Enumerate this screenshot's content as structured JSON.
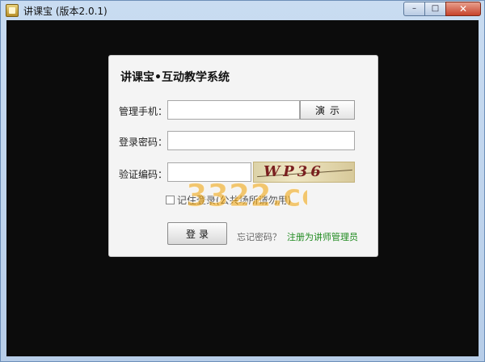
{
  "window": {
    "title": "讲课宝 (版本2.0.1)",
    "controls": {
      "minimize": "–",
      "maximize": "□",
      "close": "✕"
    }
  },
  "login": {
    "heading": "讲课宝•互动教学系统",
    "phone_label": "管理手机：",
    "phone_value": "",
    "demo_button": "演示",
    "password_label": "登录密码：",
    "password_value": "",
    "captcha_label": "验证编码：",
    "captcha_value": "",
    "captcha_image_text": "WP36",
    "remember_label": "记住登录(公共场所请勿用)",
    "login_button": "登录",
    "forgot_link": "忘记密码？",
    "register_link": "注册为讲师管理员"
  },
  "watermark": {
    "text": "3322.cc"
  },
  "colors": {
    "background": "#0c0c0c",
    "dialog": "#f4f4f4",
    "register_link": "#1f8a1f"
  }
}
